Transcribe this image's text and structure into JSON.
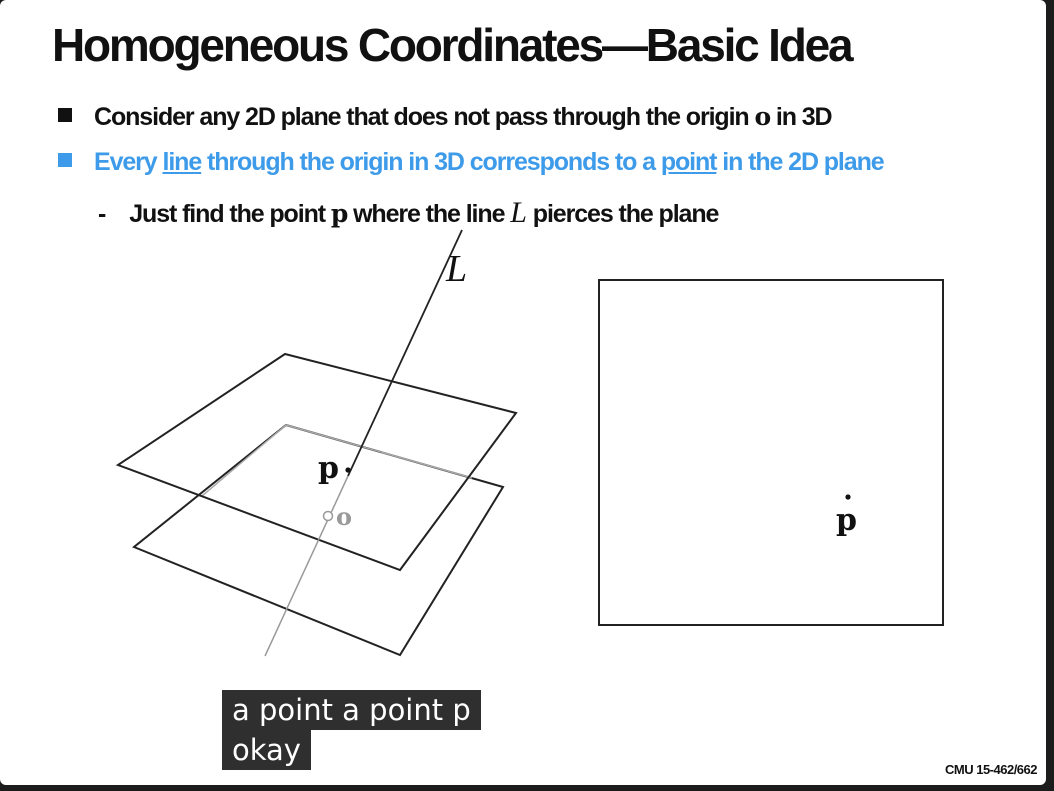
{
  "slide": {
    "title": "Homogeneous Coordinates—Basic Idea",
    "bullet1": {
      "pre": "Consider any 2D plane that does not pass through the origin ",
      "symbol": "o",
      "post": " in 3D"
    },
    "bullet2": {
      "pre": "Every ",
      "link1": "line",
      "mid": " through the origin in 3D corresponds to a ",
      "link2": "point",
      "post": " in the 2D plane"
    },
    "sub": {
      "dash": "-",
      "pre": "Just find the point ",
      "symbol_p": "p",
      "mid": " where the line ",
      "symbol_L": "L",
      "post": " pierces the plane"
    },
    "footer": "CMU 15-462/662"
  },
  "diagram": {
    "label_L": "L",
    "label_p": "p",
    "label_o": "o",
    "plane_label_p": "p"
  },
  "captions": {
    "line1": "a point a point p",
    "line2": "okay"
  },
  "colors": {
    "accent_blue": "#3d9be9",
    "caption_bg": "#2f2f2f"
  }
}
